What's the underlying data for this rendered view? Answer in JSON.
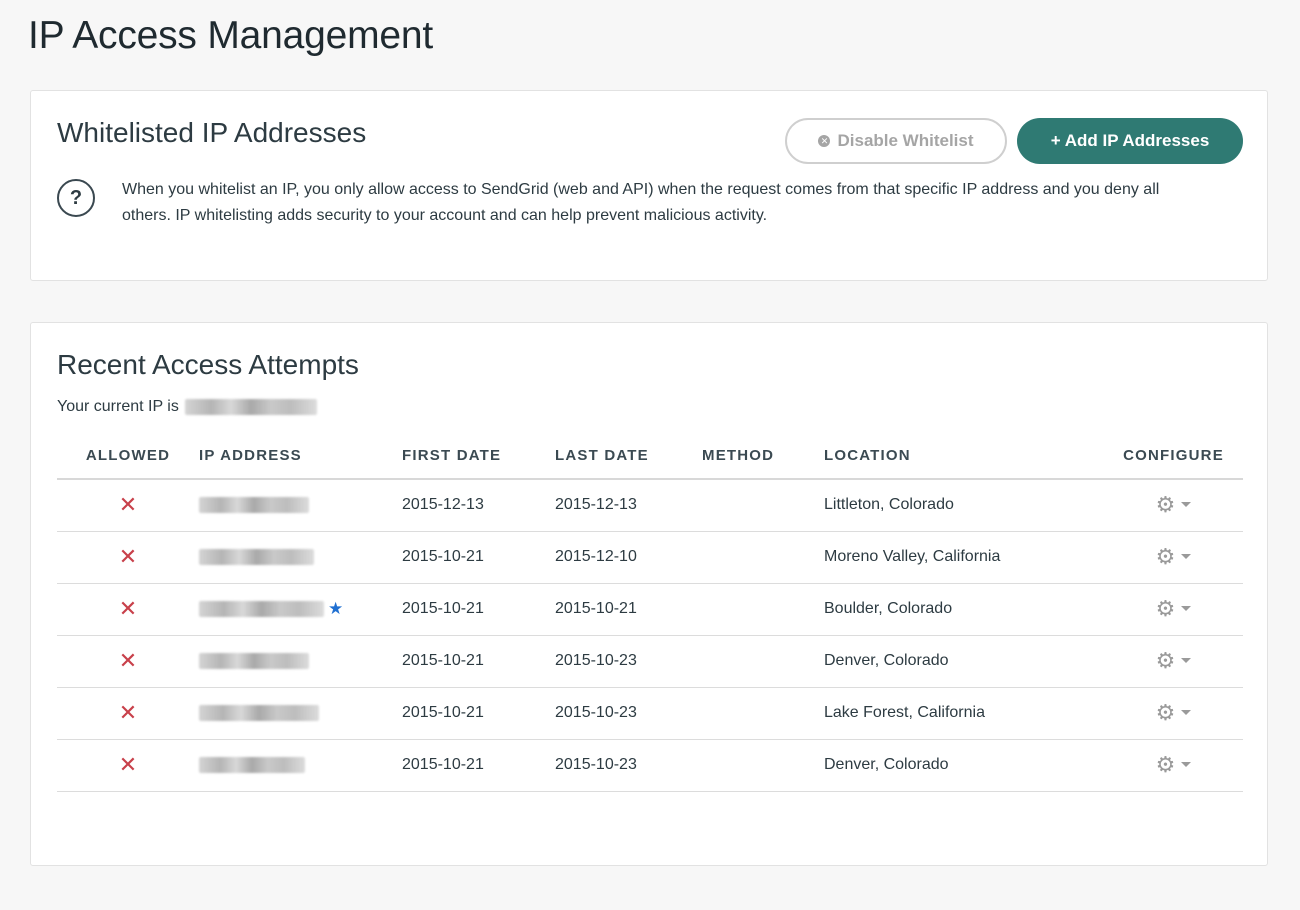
{
  "page": {
    "title": "IP Access Management"
  },
  "whitelist": {
    "title": "Whitelisted IP Addresses",
    "disable_label": "Disable Whitelist",
    "add_label": "+ Add IP Addresses",
    "help_icon": "?",
    "description": "When you whitelist an IP, you only allow access to SendGrid (web and API) when the request comes from that specific IP address and you deny all others. IP whitelisting adds security to your account and can help prevent malicious activity."
  },
  "attempts": {
    "title": "Recent Access Attempts",
    "current_ip_label": "Your current IP is",
    "columns": {
      "allowed": "ALLOWED",
      "ip": "IP ADDRESS",
      "first": "FIRST DATE",
      "last": "LAST DATE",
      "method": "METHOD",
      "location": "LOCATION",
      "configure": "CONFIGURE"
    },
    "rows": [
      {
        "allowed": "✕",
        "first": "2015-12-13",
        "last": "2015-12-13",
        "method": "",
        "location": "Littleton, Colorado",
        "current": false
      },
      {
        "allowed": "✕",
        "first": "2015-10-21",
        "last": "2015-12-10",
        "method": "",
        "location": "Moreno Valley, California",
        "current": false
      },
      {
        "allowed": "✕",
        "first": "2015-10-21",
        "last": "2015-10-21",
        "method": "",
        "location": "Boulder, Colorado",
        "current": true
      },
      {
        "allowed": "✕",
        "first": "2015-10-21",
        "last": "2015-10-23",
        "method": "",
        "location": "Denver, Colorado",
        "current": false
      },
      {
        "allowed": "✕",
        "first": "2015-10-21",
        "last": "2015-10-23",
        "method": "",
        "location": "Lake Forest, California",
        "current": false
      },
      {
        "allowed": "✕",
        "first": "2015-10-21",
        "last": "2015-10-23",
        "method": "",
        "location": "Denver, Colorado",
        "current": false
      }
    ]
  },
  "icons": {
    "help": "question-circle-icon",
    "disable": "x-circle-icon",
    "denied": "x-mark-icon",
    "current_ip": "star-icon",
    "configure": "gear-icon",
    "dropdown": "caret-down-icon"
  },
  "colors": {
    "accent": "#2f7a73",
    "denied": "#c8404a",
    "star": "#1f6fd1"
  }
}
